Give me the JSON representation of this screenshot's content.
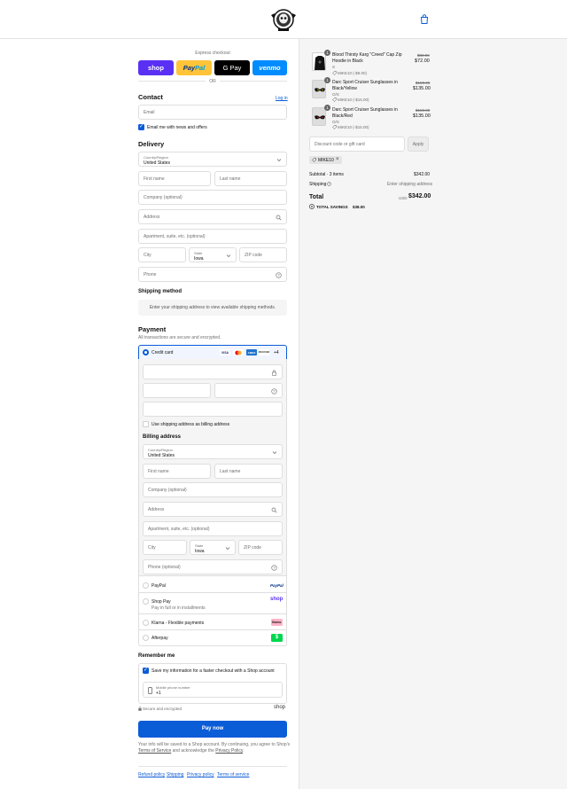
{
  "header": {
    "logo_icon": "skull-crest-logo-icon",
    "bag_icon": "shopping-bag-icon"
  },
  "express": {
    "label": "Express checkout",
    "shop": "shop",
    "paypal_a": "Pay",
    "paypal_b": "Pal",
    "gpay": "G Pay",
    "venmo": "venmo",
    "or": "OR"
  },
  "contact": {
    "title": "Contact",
    "login": "Log in",
    "email_placeholder": "Email",
    "news_label": "Email me with news and offers"
  },
  "delivery": {
    "title": "Delivery",
    "country_label": "Country/Region",
    "country_value": "United States",
    "first_name": "First name",
    "last_name": "Last name",
    "company": "Company (optional)",
    "address": "Address",
    "apartment": "Apartment, suite, etc. (optional)",
    "city": "City",
    "state_label": "State",
    "state_value": "Iowa",
    "zip": "ZIP code",
    "phone": "Phone"
  },
  "shipping_method": {
    "title": "Shipping method",
    "message": "Enter your shipping address to view available shipping methods."
  },
  "payment": {
    "title": "Payment",
    "subtitle": "All transactions are secure and encrypted.",
    "credit_card": "Credit card",
    "more_cards": "+4",
    "card_visa": "VISA",
    "card_amex": "AMEX",
    "card_discover": "DISCOVER",
    "use_shipping": "Use shipping address as billing address",
    "billing_title": "Billing address",
    "paypal": "PayPal",
    "paypal_logo": "PayPal",
    "shop_pay": "Shop Pay",
    "shop_pay_sub": "Pay in full or in installments",
    "shop_logo": "shop",
    "klarna": "Klarna - Flexible payments",
    "klarna_logo": "Klarna.",
    "afterpay": "Afterpay",
    "afterpay_logo": "$"
  },
  "remember": {
    "title": "Remember me",
    "save_label": "Save my information for a faster checkout with a Shop account",
    "mobile_label": "Mobile phone number",
    "mobile_prefix": "+1",
    "secure": "Secure and encrypted",
    "shop_logo": "shop"
  },
  "pay_button": "Pay now",
  "legal": {
    "line1": "Your info will be saved to a Shop account. By continuing, you agree to Shop's",
    "terms": "Terms of Service",
    "and": "and acknowledge the",
    "privacy": "Privacy Policy",
    "period": "."
  },
  "footer_links": [
    "Refund policy",
    "Shipping",
    "Privacy policy",
    "Terms of service"
  ],
  "cart": {
    "items": [
      {
        "name_1": "Blood Thirsty Karg \"Creed\" Cap Zip",
        "name_2": "Hoodie in Black",
        "variant": "S",
        "discount": "MIKE10 (-$8.00)",
        "old_price": "$80.00",
        "price": "$72.00",
        "qty": "1"
      },
      {
        "name_1": "Darc Sport Cruiser Sunglasses in",
        "name_2": "Black/Yellow",
        "variant": "O/S",
        "discount": "MIKE10 (-$15.00)",
        "old_price": "$150.00",
        "price": "$135.00",
        "qty": "1"
      },
      {
        "name_1": "Darc Sport Cruiser Sunglasses in",
        "name_2": "Black/Red",
        "variant": "O/S",
        "discount": "MIKE10 (-$15.00)",
        "old_price": "$150.00",
        "price": "$135.00",
        "qty": "1"
      }
    ],
    "discount_placeholder": "Discount code or gift card",
    "apply": "Apply",
    "applied_code": "MIKE10",
    "subtotal_label": "Subtotal · 3 items",
    "subtotal_value": "$342.00",
    "shipping_label": "Shipping",
    "shipping_value": "Enter shipping address",
    "total_label": "Total",
    "currency": "USD",
    "total_value": "$342.00",
    "savings_label": "TOTAL SAVINGS",
    "savings_value": "$38.00"
  },
  "colors": {
    "accent": "#0b5cd7",
    "shop": "#5a31f4",
    "paypal": "#ffc439",
    "venmo": "#008cff",
    "right_bg": "#f5f5f5"
  }
}
